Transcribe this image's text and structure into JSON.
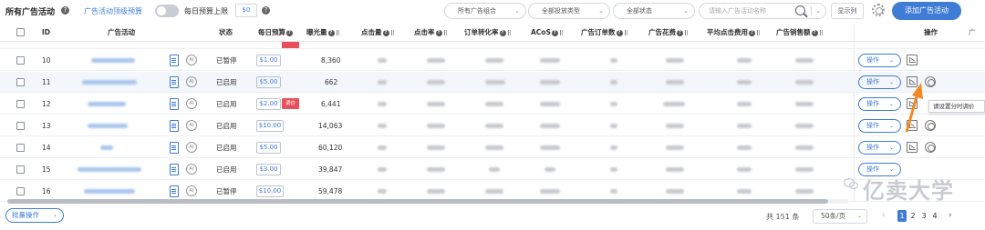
{
  "toolbar": {
    "title": "所有广告活动",
    "top_budget_label": "广告活动顶级预算",
    "daily_budget_label": "每日预算上限",
    "daily_budget_value": "$0",
    "select_portfolio": "所有广告组合",
    "select_delivery": "全部投放类型",
    "select_status": "全部状态",
    "search_placeholder": "请输入广告活动名称",
    "columns_button": "显示列",
    "add_button": "添加广告活动"
  },
  "table": {
    "headers": {
      "id": "ID",
      "campaign": "广告活动",
      "status": "状态",
      "daily_budget": "每日预算",
      "impressions": "曝光量",
      "clicks": "点击量",
      "ctr": "点击率",
      "cvr": "订单转化率",
      "acos": "ACoS",
      "orders": "广告订单数",
      "spend": "广告花费",
      "cpc": "平均点击费用",
      "sales": "广告销售额",
      "actions": "操作",
      "overflow": "广"
    },
    "rows": [
      {
        "id": "10",
        "status": "已暂停",
        "budget": "$1.00",
        "impressions": "8,360",
        "tag": ""
      },
      {
        "id": "11",
        "status": "已启用",
        "budget": "$5.00",
        "impressions": "662",
        "tag": ""
      },
      {
        "id": "12",
        "status": "已启用",
        "budget": "$2.00",
        "impressions": "6,441",
        "tag": "调价"
      },
      {
        "id": "13",
        "status": "已启用",
        "budget": "$10.00",
        "impressions": "14,063",
        "tag": ""
      },
      {
        "id": "14",
        "status": "已启用",
        "budget": "$5.00",
        "impressions": "60,120",
        "tag": ""
      },
      {
        "id": "15",
        "status": "已启用",
        "budget": "$3.00",
        "impressions": "39,847",
        "tag": ""
      },
      {
        "id": "16",
        "status": "已暂停",
        "budget": "$10.00",
        "impressions": "59,478",
        "tag": ""
      }
    ],
    "action_label": "操作",
    "ai_label": "AI",
    "tooltip": "请设置分时调价"
  },
  "footer": {
    "batch_button": "批量操作",
    "total": "共 151 条",
    "page_size": "50条/页",
    "pages": [
      "1",
      "2",
      "3",
      "4"
    ],
    "current_page": "1"
  },
  "watermark": "亿卖大学",
  "colors": {
    "accent": "#3f7cd6",
    "tag_red": "#e8505b",
    "arrow_orange": "#f08a24"
  },
  "icons": [
    "help-icon",
    "search-icon",
    "gear-icon",
    "document-icon",
    "ai-icon",
    "chart-icon",
    "clock-icon",
    "chevron-down-icon",
    "arrow-pointer-icon"
  ]
}
